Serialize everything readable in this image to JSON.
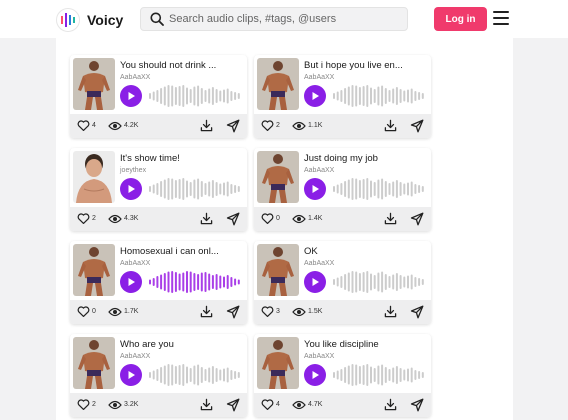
{
  "app": {
    "name": "Voicy",
    "logo_icon": "waveform-bars-icon",
    "brand_colors": [
      "#ff4f6d",
      "#8a1fe6",
      "#2a7bd8",
      "#1fb5a4"
    ]
  },
  "search": {
    "placeholder": "Search audio clips, #tags, @users",
    "value": ""
  },
  "header": {
    "login_label": "Log in",
    "login_color": "#f03a6c",
    "menu_icon": "hamburger-menu-icon"
  },
  "accent": {
    "play": "#8a1fe6",
    "wave_idle": "#cccccc",
    "wave_active": "#a93ee8"
  },
  "clips": [
    {
      "title": "You should not drink ...",
      "user": "AabAaXX",
      "likes": "4",
      "views": "4.2K",
      "thumb": "fig-tan",
      "playing": false
    },
    {
      "title": "But i hope you live en...",
      "user": "AabAaXX",
      "likes": "2",
      "views": "1.1K",
      "thumb": "fig-tan",
      "playing": false
    },
    {
      "title": "It's show time!",
      "user": "joeythex",
      "likes": "2",
      "views": "4.3K",
      "thumb": "fig-smile",
      "playing": false
    },
    {
      "title": "Just doing my job",
      "user": "AabAaXX",
      "likes": "0",
      "views": "1.4K",
      "thumb": "fig-tan",
      "playing": false
    },
    {
      "title": "Homosexual i can onl...",
      "user": "AabAaXX",
      "likes": "0",
      "views": "1.7K",
      "thumb": "fig-tan",
      "playing": true
    },
    {
      "title": "OK",
      "user": "AabAaXX",
      "likes": "3",
      "views": "1.5K",
      "thumb": "fig-tan",
      "playing": false
    },
    {
      "title": "Who are you",
      "user": "AabAaXX",
      "likes": "2",
      "views": "3.2K",
      "thumb": "fig-tan",
      "playing": false
    },
    {
      "title": "You like discipline",
      "user": "AabAaXX",
      "likes": "4",
      "views": "4.7K",
      "thumb": "fig-tan",
      "playing": false
    }
  ]
}
